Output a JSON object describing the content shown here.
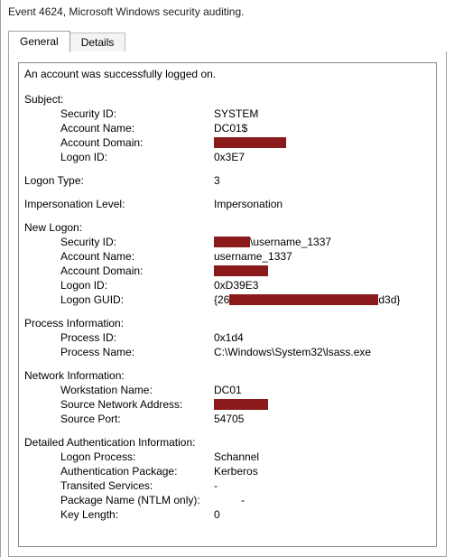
{
  "title": "Event 4624, Microsoft Windows security auditing.",
  "tabs": {
    "general": "General",
    "details": "Details"
  },
  "message": "An account was successfully logged on.",
  "subject": {
    "title": "Subject:",
    "security_id_label": "Security ID:",
    "security_id_value": "SYSTEM",
    "account_name_label": "Account Name:",
    "account_name_value": "DC01$",
    "account_domain_label": "Account Domain:",
    "logon_id_label": "Logon ID:",
    "logon_id_value": "0x3E7"
  },
  "logon_type": {
    "label": "Logon Type:",
    "value": "3"
  },
  "impersonation": {
    "label": "Impersonation Level:",
    "value": "Impersonation"
  },
  "new_logon": {
    "title": "New Logon:",
    "security_id_label": "Security ID:",
    "security_id_suffix": "\\username_1337",
    "account_name_label": "Account Name:",
    "account_name_value": "username_1337",
    "account_domain_label": "Account Domain:",
    "logon_id_label": "Logon ID:",
    "logon_id_value": "0xD39E3",
    "logon_guid_label": "Logon GUID:",
    "logon_guid_prefix": "{26",
    "logon_guid_suffix": "d3d}"
  },
  "process_info": {
    "title": "Process Information:",
    "process_id_label": "Process ID:",
    "process_id_value": "0x1d4",
    "process_name_label": "Process Name:",
    "process_name_value": "C:\\Windows\\System32\\lsass.exe"
  },
  "network_info": {
    "title": "Network Information:",
    "workstation_label": "Workstation Name:",
    "workstation_value": "DC01",
    "source_addr_label": "Source Network Address:",
    "source_port_label": "Source Port:",
    "source_port_value": "54705"
  },
  "auth_info": {
    "title": "Detailed Authentication Information:",
    "logon_process_label": "Logon Process:",
    "logon_process_value": "Schannel",
    "auth_package_label": "Authentication Package:",
    "auth_package_value": "Kerberos",
    "transited_label": "Transited Services:",
    "transited_value": "-",
    "package_name_label": "Package Name (NTLM only):",
    "package_name_value": "-",
    "key_length_label": "Key Length:",
    "key_length_value": "0"
  }
}
